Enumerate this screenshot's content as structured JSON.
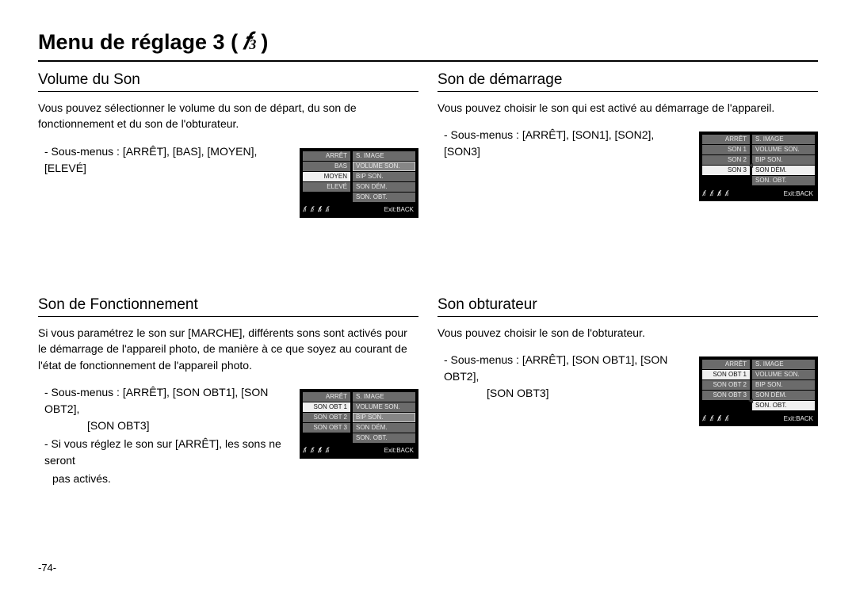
{
  "page_title_prefix": "Menu de réglage 3 (",
  "page_title_suffix": ")",
  "page_number": "-74-",
  "figure_exit_label": "Exit:BACK",
  "wrench_sub": "3",
  "sections": {
    "volume": {
      "title": "Volume du Son",
      "lead": "Vous pouvez sélectionner le volume du son de départ, du son de fonctionnement et du son de l'obturateur.",
      "sub_line": "- Sous-menus : [ARRÊT], [BAS], [MOYEN], [ELEVÉ]",
      "figure": {
        "left": [
          "ARRÊT",
          "BAS",
          "MOYEN",
          "ELEVÉ",
          ""
        ],
        "right": [
          "S. IMAGE",
          "VOLUME SON.",
          "BIP SON.",
          "SON DÉM.",
          "SON. OBT."
        ],
        "selected_left_index": 2,
        "highlight_right_index": 1,
        "arrow_right_index": -1
      }
    },
    "startup": {
      "title": "Son de démarrage",
      "lead": "Vous pouvez choisir le son qui est activé au démarrage de l'appareil.",
      "sub_line": "- Sous-menus : [ARRÊT], [SON1], [SON2], [SON3]",
      "figure": {
        "left": [
          "ARRÊT",
          "SON 1",
          "SON 2",
          "SON 3",
          ""
        ],
        "right": [
          "S. IMAGE",
          "VOLUME SON.",
          "BIP SON.",
          "SON DÉM.",
          "SON. OBT."
        ],
        "selected_left_index": 3,
        "highlight_right_index": -1,
        "selected_right_index": 3,
        "arrow_right_index": 3
      }
    },
    "operation": {
      "title": "Son de Fonctionnement",
      "lead": "Si vous paramétrez le son sur [MARCHE], différents sons sont activés pour le démarrage de l'appareil photo, de manière à ce que soyez au courant de l'état de fonctionnement de l'appareil photo.",
      "sub_line": "- Sous-menus : [ARRÊT], [SON OBT1], [SON OBT2],",
      "sub_line2": "[SON OBT3]",
      "note1": "- Si vous réglez le son sur [ARRÊT], les sons ne seront",
      "note1b": "pas activés.",
      "figure": {
        "left": [
          "ARRÊT",
          "SON OBT 1",
          "SON OBT 2",
          "SON OBT 3",
          ""
        ],
        "right": [
          "S. IMAGE",
          "VOLUME SON.",
          "BIP SON.",
          "SON DÉM.",
          "SON. OBT."
        ],
        "selected_left_index": 1,
        "highlight_right_index": 2,
        "arrow_right_index": -1
      }
    },
    "shutter": {
      "title": "Son obturateur",
      "lead": "Vous pouvez choisir le son de l'obturateur.",
      "sub_line": "- Sous-menus : [ARRÊT], [SON OBT1], [SON OBT2],",
      "sub_line2": "[SON OBT3]",
      "figure": {
        "left": [
          "ARRÊT",
          "SON OBT 1",
          "SON OBT 2",
          "SON OBT 3",
          ""
        ],
        "right": [
          "S. IMAGE",
          "VOLUME SON.",
          "BIP SON.",
          "SON DÉM.",
          "SON. OBT."
        ],
        "selected_left_index": 1,
        "highlight_right_index": -1,
        "selected_right_index": 4,
        "arrow_right_index": 4
      }
    }
  }
}
